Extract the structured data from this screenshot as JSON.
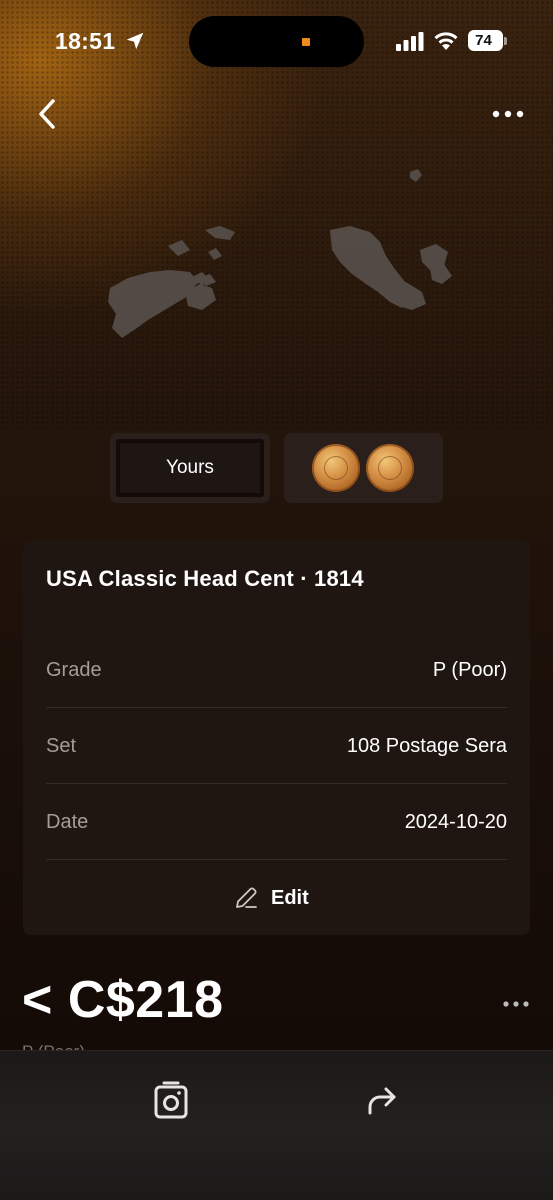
{
  "status_bar": {
    "time": "18:51",
    "battery": "74",
    "icons": [
      "location-arrow-icon",
      "signal-icon",
      "wifi-icon",
      "battery-icon"
    ],
    "recording_indicator_color": "#f08a1d"
  },
  "nav": {
    "back_icon": "chevron-left-icon",
    "more_icon": "ellipsis-icon"
  },
  "tabs": {
    "yours_label": "Yours",
    "coins_icon": "coin-images"
  },
  "card": {
    "title": "USA Classic Head Cent · 1814",
    "rows": [
      {
        "label": "Grade",
        "value": "P (Poor)"
      },
      {
        "label": "Set",
        "value": "108 Postage Sera"
      },
      {
        "label": "Date",
        "value": "2024-10-20"
      }
    ],
    "edit_label": "Edit",
    "edit_icon": "pencil-icon"
  },
  "price": {
    "value": "< C$218",
    "more_icon": "ellipsis-icon",
    "subtitle": "P (Poor)"
  },
  "bottom_bar": {
    "scan_icon": "camera-scan-icon",
    "share_icon": "share-arrow-icon"
  },
  "colors": {
    "background": "#130b07",
    "card": "#1f1612",
    "muted_text": "#a59c98",
    "accent_glow": "#c47814"
  }
}
